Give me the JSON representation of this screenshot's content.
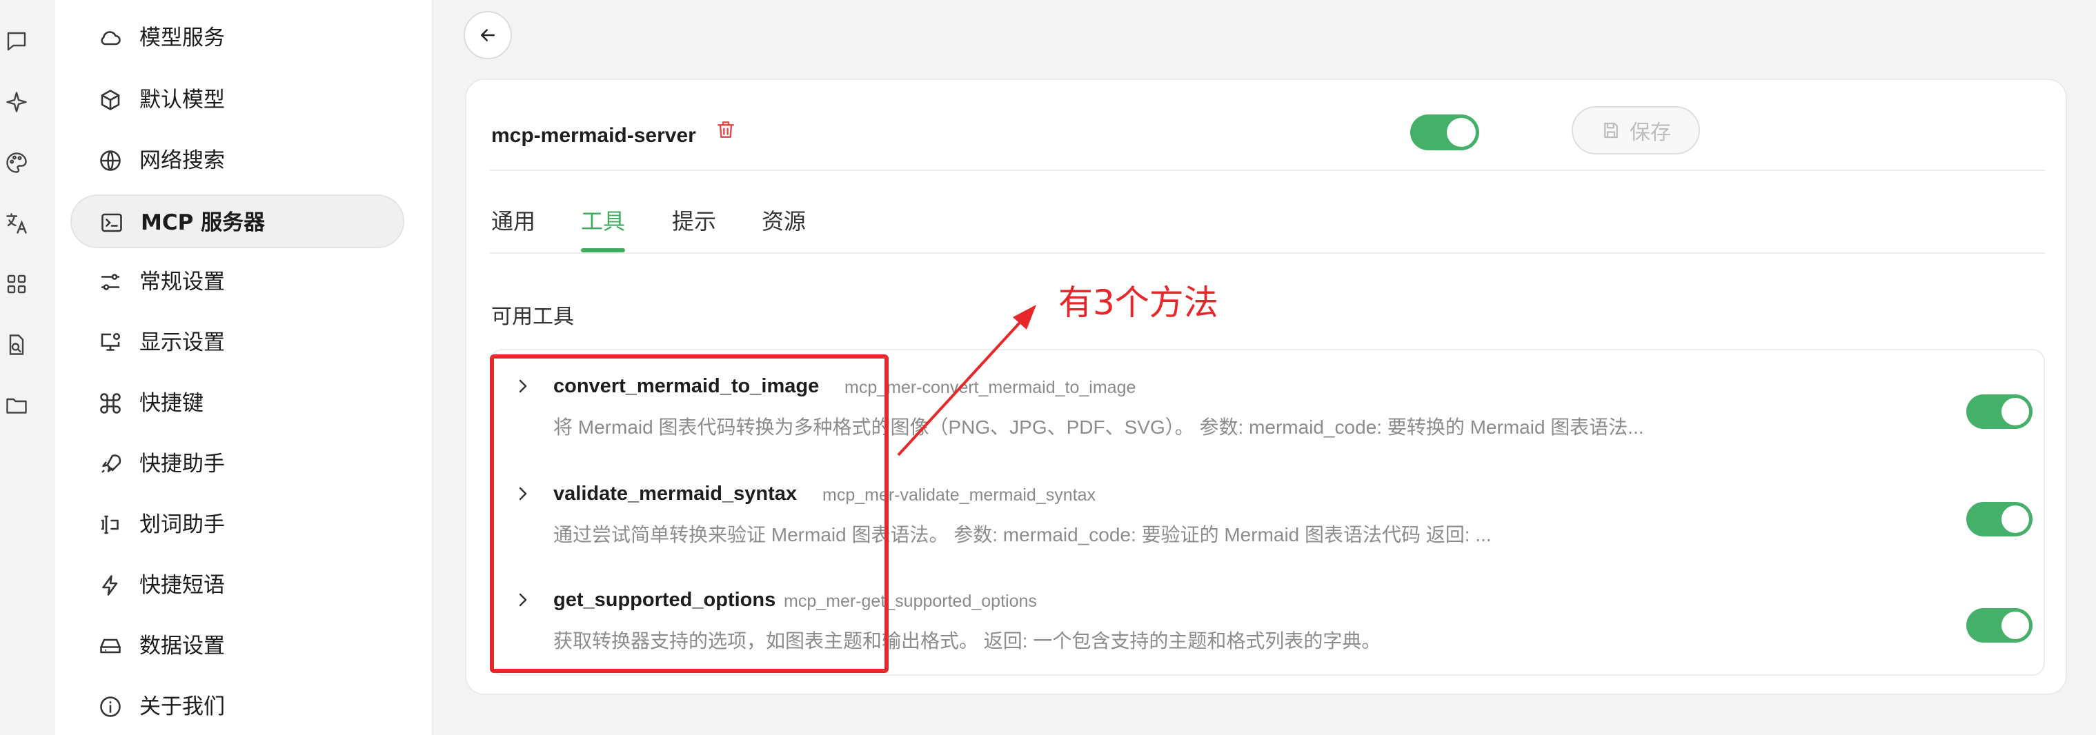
{
  "nav": {
    "items": [
      {
        "label": "模型服务",
        "icon": "cloud-icon"
      },
      {
        "label": "默认模型",
        "icon": "cube-icon"
      },
      {
        "label": "网络搜索",
        "icon": "globe-icon"
      },
      {
        "label": "MCP 服务器",
        "icon": "terminal-icon",
        "active": true
      },
      {
        "label": "常规设置",
        "icon": "sliders-icon"
      },
      {
        "label": "显示设置",
        "icon": "monitor-settings-icon"
      },
      {
        "label": "快捷键",
        "icon": "command-icon"
      },
      {
        "label": "快捷助手",
        "icon": "rocket-icon"
      },
      {
        "label": "划词助手",
        "icon": "text-select-icon"
      },
      {
        "label": "快捷短语",
        "icon": "zap-icon"
      },
      {
        "label": "数据设置",
        "icon": "hard-drive-icon"
      },
      {
        "label": "关于我们",
        "icon": "info-icon"
      }
    ]
  },
  "rail": {
    "icons": [
      "chat-icon",
      "sparkle-icon",
      "palette-icon",
      "translate-icon",
      "apps-grid-icon",
      "doc-search-icon",
      "folder-icon"
    ]
  },
  "server": {
    "name": "mcp-mermaid-server",
    "enabled": true,
    "save_label": "保存"
  },
  "tabs": [
    {
      "label": "通用"
    },
    {
      "label": "工具",
      "active": true
    },
    {
      "label": "提示"
    },
    {
      "label": "资源"
    }
  ],
  "tools_section_title": "可用工具",
  "tools": [
    {
      "name": "convert_mermaid_to_image",
      "id": "mcp_mer-convert_mermaid_to_image",
      "description": "将 Mermaid 图表代码转换为多种格式的图像（PNG、JPG、PDF、SVG）。 参数: mermaid_code: 要转换的 Mermaid 图表语法...",
      "enabled": true
    },
    {
      "name": "validate_mermaid_syntax",
      "id": "mcp_mer-validate_mermaid_syntax",
      "description": "通过尝试简单转换来验证 Mermaid 图表语法。 参数: mermaid_code: 要验证的 Mermaid 图表语法代码 返回: ...",
      "enabled": true
    },
    {
      "name": "get_supported_options",
      "id": "mcp_mer-get_supported_options",
      "description": "获取转换器支持的选项，如图表主题和输出格式。 返回: 一个包含支持的主题和格式列表的字典。",
      "enabled": true
    }
  ],
  "annotation": {
    "text": "有3个方法",
    "color": "#e8272b"
  },
  "colors": {
    "accent": "#3eab5f",
    "toggle_on": "#44b06a",
    "danger": "#e04848"
  }
}
